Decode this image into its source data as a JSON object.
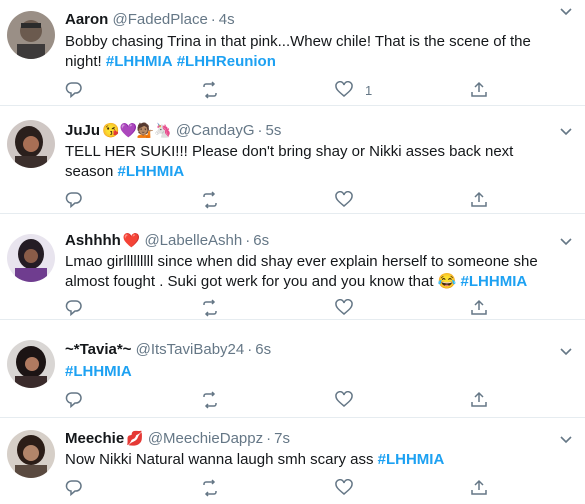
{
  "tweets": [
    {
      "name": "Aaron",
      "emojis": "",
      "handle": "@FadedPlace",
      "time": "4s",
      "text_parts": [
        "Bobby chasing Trina in that pink...Whew chile! That is the scene of the night! "
      ],
      "hashtags": [
        "#LHHMIA",
        "#LHHReunion"
      ],
      "likes": "1"
    },
    {
      "name": "JuJu",
      "emojis": "😘💜💁🏽🦄",
      "handle": "@CandayG",
      "time": "5s",
      "text_parts": [
        "TELL HER SUKI!!! Please don't bring shay or Nikki asses back next season "
      ],
      "hashtags": [
        "#LHHMIA"
      ],
      "likes": ""
    },
    {
      "name": "Ashhhh",
      "emojis": "❤️",
      "handle": "@LabelleAshh",
      "time": "6s",
      "text_parts": [
        "Lmao girlllllllll since when did shay ever explain herself to someone she almost fought . Suki got werk for you and you know that 😂 "
      ],
      "hashtags": [
        "#LHHMIA"
      ],
      "likes": ""
    },
    {
      "name": "~*Tavia*~",
      "emojis": "",
      "handle": "@ItsTaviBaby24",
      "time": "6s",
      "text_parts": [
        ""
      ],
      "hashtags": [
        "#LHHMIA"
      ],
      "likes": ""
    },
    {
      "name": "Meechie",
      "emojis": "💋",
      "handle": "@MeechieDappz",
      "time": "7s",
      "text_parts": [
        "Now Nikki Natural wanna laugh smh scary ass "
      ],
      "hashtags": [
        "#LHHMIA"
      ],
      "likes": ""
    }
  ],
  "colors": {
    "accent": "#1da1f2",
    "muted": "#657786",
    "text": "#14171a"
  }
}
